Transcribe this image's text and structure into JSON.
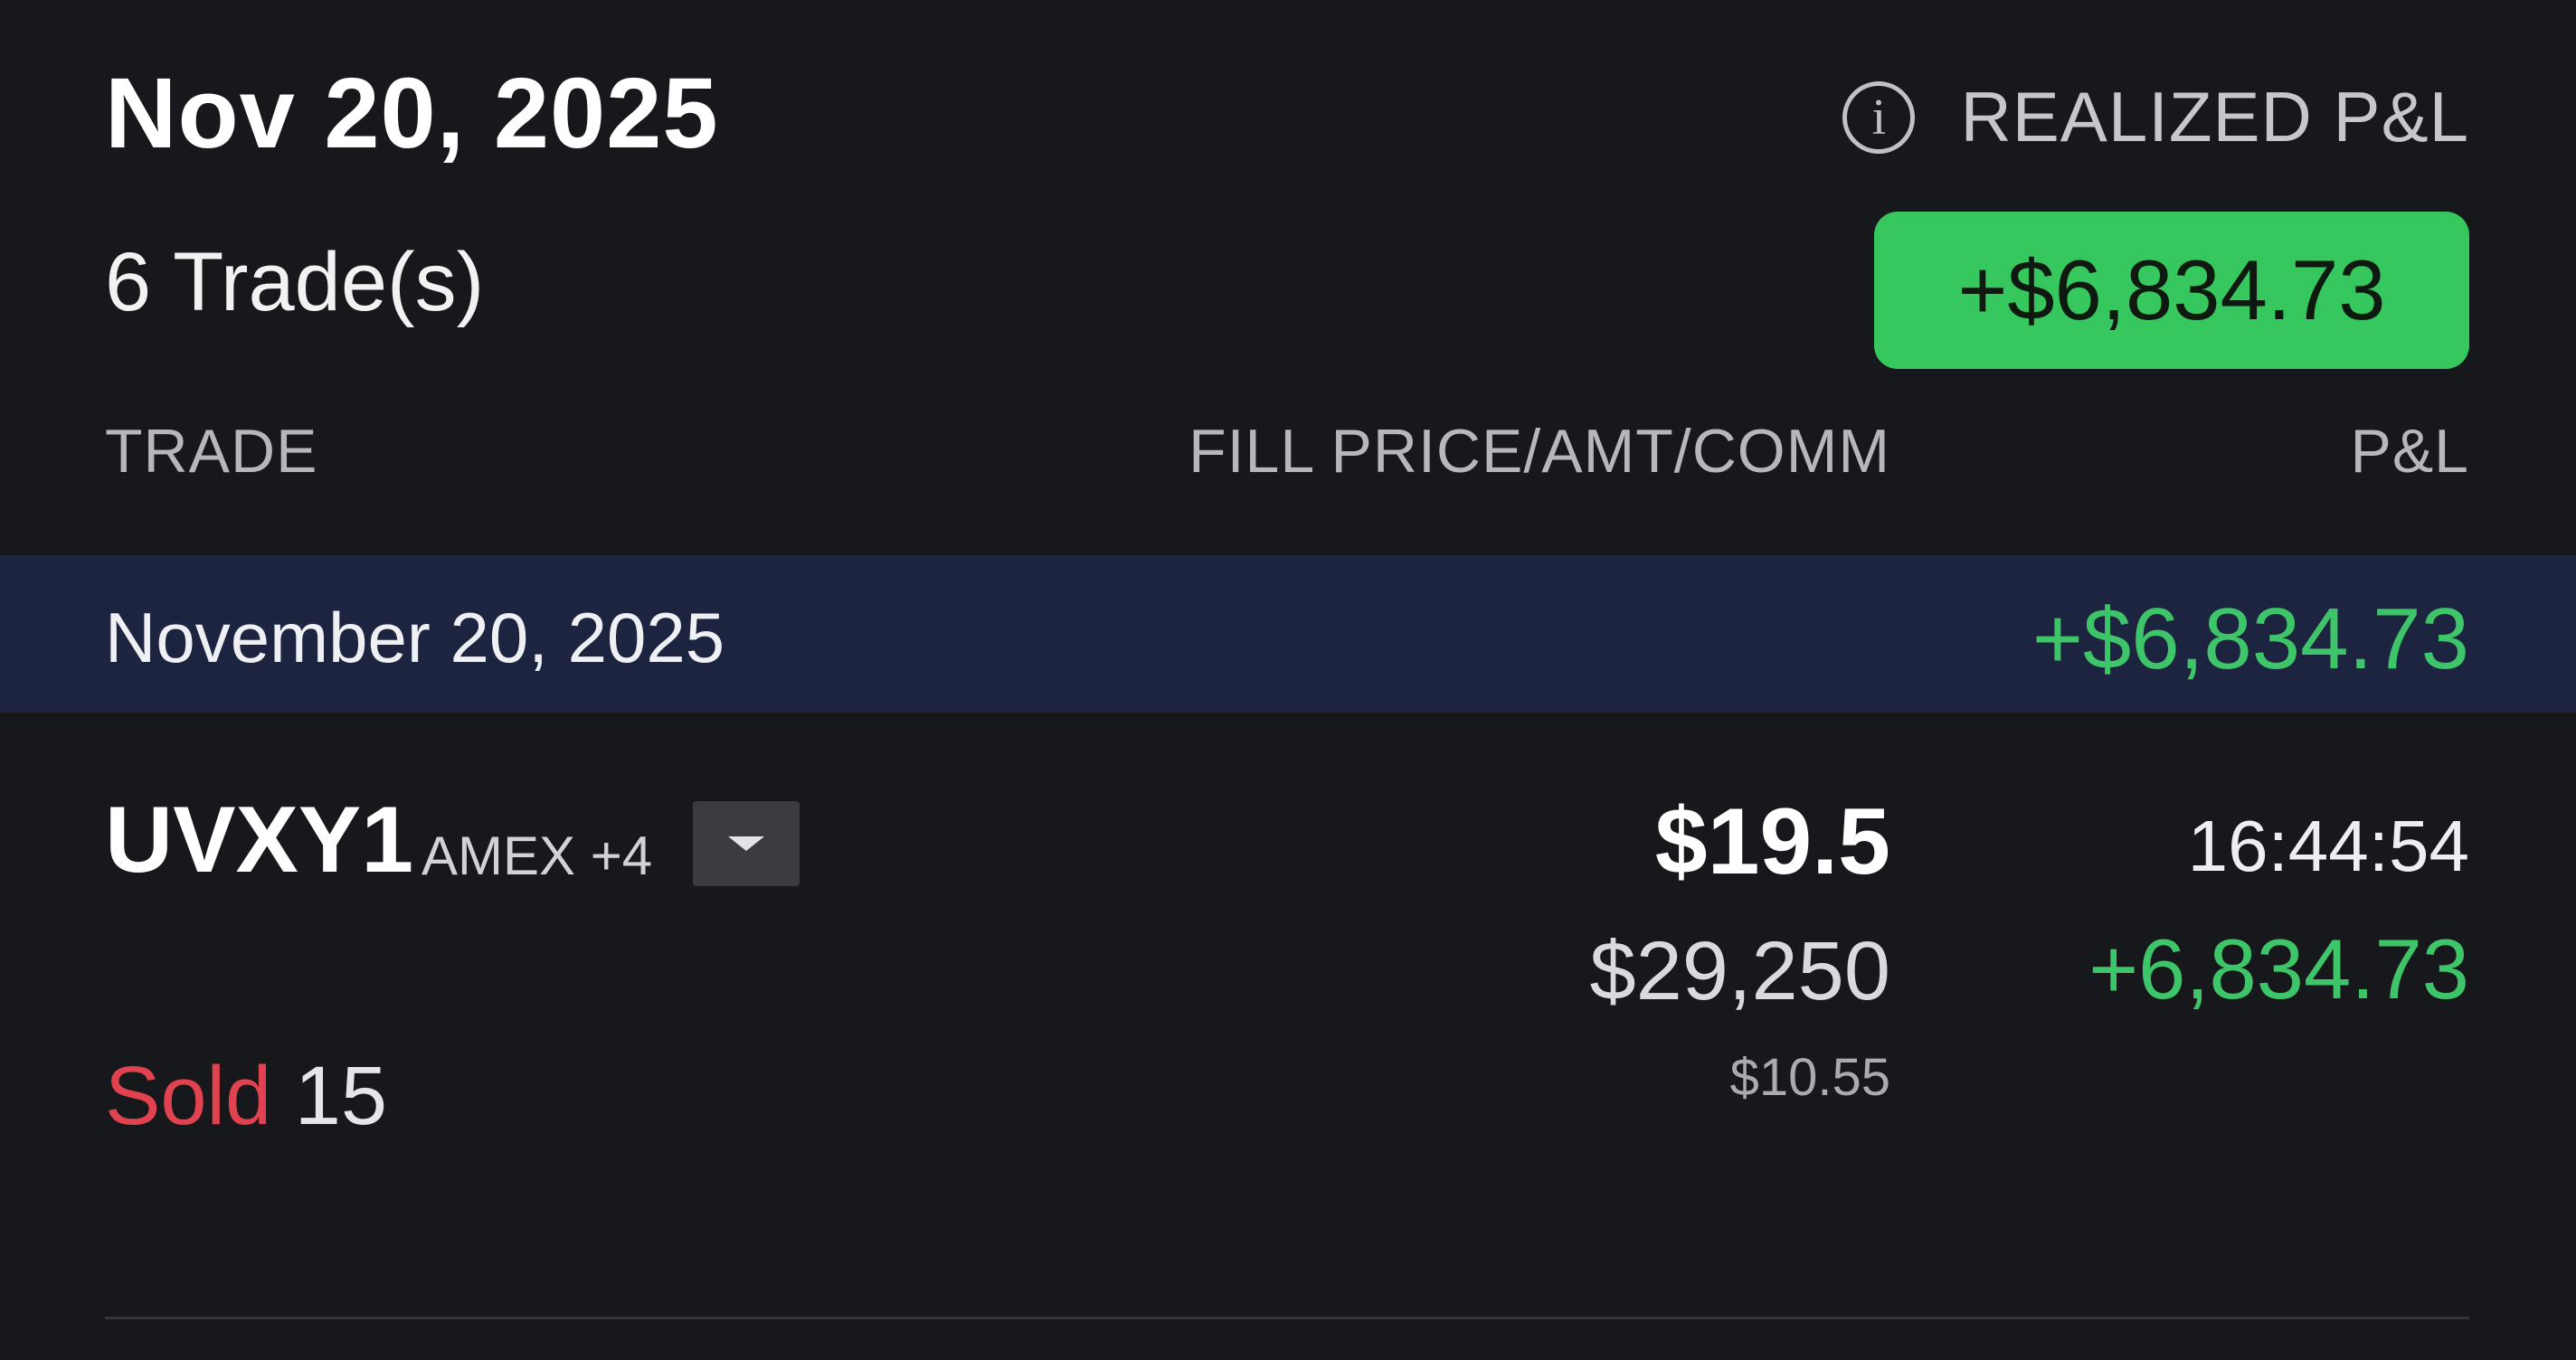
{
  "summary": {
    "date": "Nov 20, 2025",
    "trade_count": "6 Trade(s)",
    "realized_label": "REALIZED P&L",
    "realized_value": "+$6,834.73",
    "info_icon": "info-icon",
    "badge_color": "#36c75e"
  },
  "columns": {
    "trade": "TRADE",
    "fill": "FILL PRICE/AMT/COMM",
    "pnl": "P&L"
  },
  "group": {
    "date": "November 20, 2025",
    "pnl": "+$6,834.73",
    "background_color": "#1c2440"
  },
  "trade": {
    "symbol": "UVXY1",
    "exchange": "AMEX +4",
    "dropdown_icon": "chevron-down-icon",
    "fill_price": "$19.5",
    "amount": "$29,250",
    "commission": "$10.55",
    "time": "16:44:54",
    "pnl": "+6,834.73",
    "side": "Sold",
    "quantity": "15"
  },
  "colors": {
    "positive": "#3fc569",
    "negative": "#e0424f",
    "background": "#17181c"
  }
}
